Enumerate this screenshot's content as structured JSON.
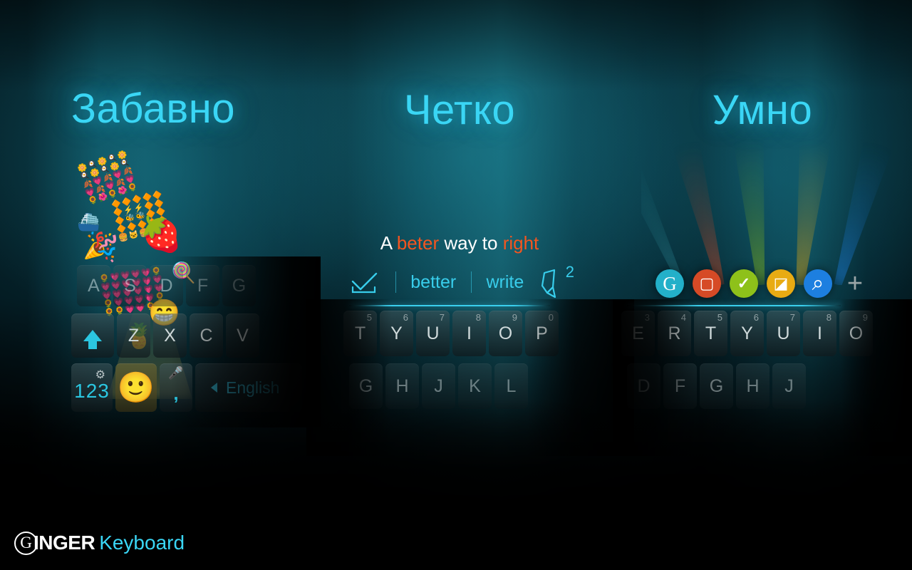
{
  "brand": {
    "logo_mark": "G",
    "name_primary": "INGER",
    "name_secondary": "Keyboard",
    "accent_cyan": "#3ad6f5",
    "error_orange": "#f4551f"
  },
  "panels": {
    "fun": {
      "headline": "Забавно",
      "keyboard": {
        "row_asdf": [
          "A",
          "S",
          "D",
          "F",
          "G"
        ],
        "row_zxcv": [
          "Z",
          "X",
          "C",
          "V"
        ],
        "shift_icon": "shift-arrow-icon",
        "bottom": {
          "numbers_label": "123",
          "settings_icon": "gear-icon",
          "emoji_icon": "smiley-face-icon",
          "comma_label": ",",
          "mic_icon": "microphone-icon",
          "space_label": "English",
          "space_arrow_icon": "chevron-left-icon"
        }
      },
      "stickers": [
        "emoji-grid-sticker",
        "boat-emoji",
        "party-popper-emoji",
        "strawberry-emoji",
        "lollipop-emoji",
        "hearts-grid-sticker",
        "grinning-face-emoji",
        "pineapple-emoji"
      ]
    },
    "clear": {
      "headline": "Четко",
      "sentence": {
        "parts": [
          {
            "text": "A ",
            "state": "ok"
          },
          {
            "text": "beter",
            "state": "error"
          },
          {
            "text": " way to ",
            "state": "ok"
          },
          {
            "text": "right",
            "state": "error"
          }
        ],
        "plain": "A beter way to right"
      },
      "suggestions": {
        "accept_icon": "checkmark-underline-icon",
        "items": [
          "better",
          "write"
        ],
        "pen_icon": "quill-pen-icon",
        "pen_badge": "2"
      },
      "keyboard": {
        "row_top": [
          {
            "letter": "T",
            "num": "5"
          },
          {
            "letter": "Y",
            "num": "6"
          },
          {
            "letter": "U",
            "num": "7"
          },
          {
            "letter": "I",
            "num": "8"
          },
          {
            "letter": "O",
            "num": "9"
          },
          {
            "letter": "P",
            "num": "0"
          }
        ],
        "row_mid": [
          "G",
          "H",
          "J",
          "K",
          "L"
        ]
      }
    },
    "smart": {
      "headline": "Умно",
      "app_icons": [
        {
          "name": "ginger-logo-icon",
          "glyph": "G",
          "color": "#23b0c9",
          "fg": "#ffffff"
        },
        {
          "name": "window-icon",
          "glyph": "▢",
          "color": "#d64a26",
          "fg": "#ffffff"
        },
        {
          "name": "checkmark-icon",
          "glyph": "✓",
          "color": "#8ec11a",
          "fg": "#ffffff"
        },
        {
          "name": "page-fold-icon",
          "glyph": "◪",
          "color": "#e8ab13",
          "fg": "#ffffff"
        },
        {
          "name": "search-icon",
          "glyph": "⌕",
          "color": "#1d7fe0",
          "fg": "#ffffff"
        },
        {
          "name": "add-icon",
          "glyph": "+",
          "color": "#9aa5a7",
          "fg": "#9aa5a7"
        }
      ],
      "keyboard": {
        "row_top": [
          {
            "letter": "E",
            "num": "3"
          },
          {
            "letter": "R",
            "num": "4"
          },
          {
            "letter": "T",
            "num": "5"
          },
          {
            "letter": "Y",
            "num": "6"
          },
          {
            "letter": "U",
            "num": "7"
          },
          {
            "letter": "I",
            "num": "8"
          },
          {
            "letter": "O",
            "num": "9"
          }
        ],
        "row_mid": [
          "D",
          "F",
          "G",
          "H",
          "J"
        ]
      }
    }
  }
}
